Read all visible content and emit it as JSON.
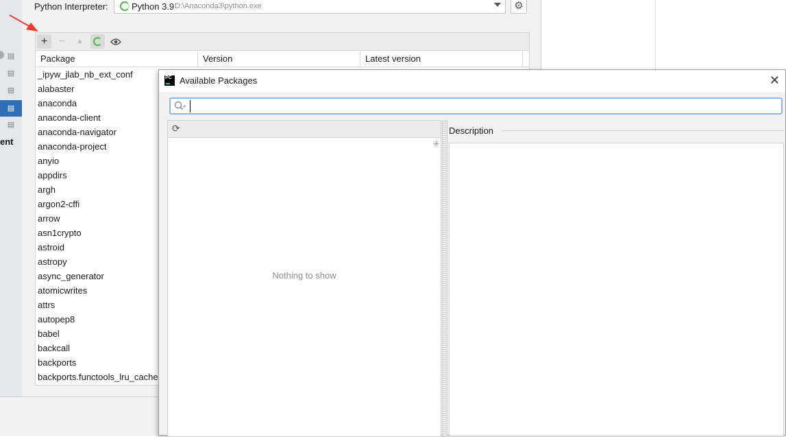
{
  "settings": {
    "interpreter_label": "Python Interpreter:",
    "interpreter_name": "Python 3.9",
    "interpreter_path": "D:\\Anaconda3\\python.exe",
    "left_strip_text": "ent"
  },
  "packages": {
    "columns": [
      "Package",
      "Version",
      "Latest version"
    ],
    "rows": [
      "_ipyw_jlab_nb_ext_conf",
      "alabaster",
      "anaconda",
      "anaconda-client",
      "anaconda-navigator",
      "anaconda-project",
      "anyio",
      "appdirs",
      "argh",
      "argon2-cffi",
      "arrow",
      "asn1crypto",
      "astroid",
      "astropy",
      "async_generator",
      "atomicwrites",
      "attrs",
      "autopep8",
      "babel",
      "backcall",
      "backports",
      "backports.functools_lru_cache"
    ]
  },
  "toolbar": {
    "add": "+",
    "remove": "−",
    "upgrade": "▲"
  },
  "dialog": {
    "logo_text": "PC",
    "title": "Available Packages",
    "search_value": "",
    "empty_text": "Nothing to show",
    "description_label": "Description"
  },
  "colors": {
    "accent": "#2e6fb5",
    "search_focus": "#8db7e6",
    "loading_green": "#4fb848",
    "annotation_red": "#f03a2e"
  }
}
